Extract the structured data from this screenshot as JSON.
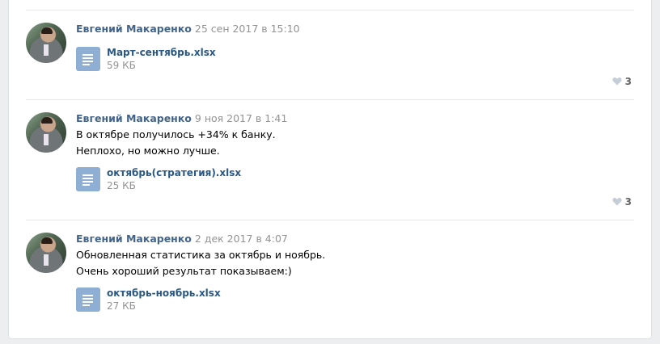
{
  "posts": [
    {
      "author": "Евгений Макаренко",
      "date": "25 сен 2017 в 15:10",
      "lines": [],
      "file": {
        "name": "Март-сентябрь.xlsx",
        "size": "59 КБ"
      },
      "likes": "3"
    },
    {
      "author": "Евгений Макаренко",
      "date": "9 ноя 2017 в 1:41",
      "lines": [
        "В октябре получилось +34% к банку.",
        "Неплохо, но можно лучше."
      ],
      "file": {
        "name": "октябрь(стратегия).xlsx",
        "size": "25 КБ"
      },
      "likes": "3"
    },
    {
      "author": "Евгений Макаренко",
      "date": "2 дек 2017 в 4:07",
      "lines": [
        "Обновленная статистика за октябрь и ноябрь.",
        "Очень хороший результат показываем:)"
      ],
      "file": {
        "name": "октябрь-ноябрь.xlsx",
        "size": "27 КБ"
      },
      "likes": null
    }
  ],
  "colors": {
    "link": "#42648b",
    "file_link": "#2a5885",
    "meta": "#939393",
    "doc_icon": "#8eaed3"
  },
  "icons": {
    "avatar": "user-photo",
    "file": "document-icon",
    "like": "heart-icon"
  }
}
